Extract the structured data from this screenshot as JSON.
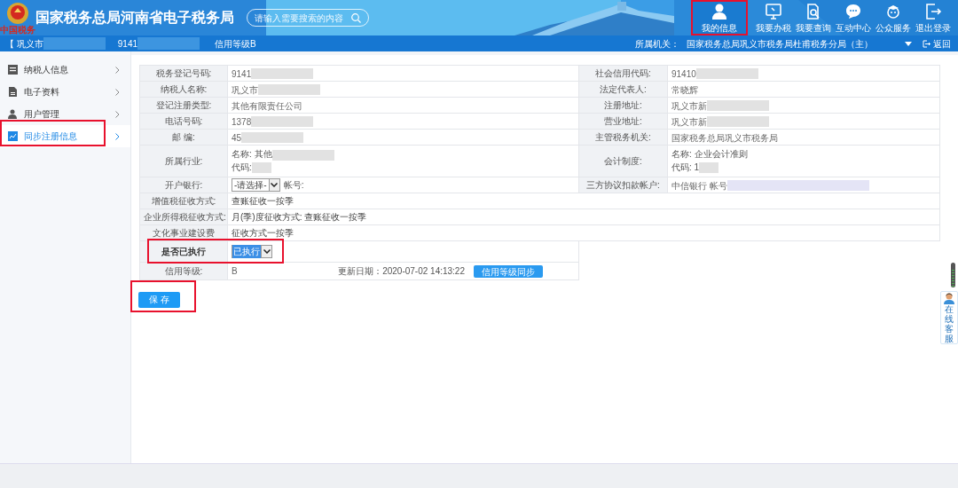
{
  "header": {
    "logo_text": "中国税务",
    "title": "国家税务总局河南省电子税务局",
    "search": {
      "placeholder": "请输入需要搜索的内容"
    },
    "nav": [
      {
        "label": "我的信息",
        "selected": true,
        "highlighted": true
      },
      {
        "label": "我要办税",
        "selected": false,
        "highlighted": false
      },
      {
        "label": "我要查询",
        "selected": false,
        "highlighted": false
      },
      {
        "label": "互动中心",
        "selected": false,
        "highlighted": false
      },
      {
        "label": "公众服务",
        "selected": false,
        "highlighted": false
      },
      {
        "label": "退出登录",
        "selected": false,
        "highlighted": false
      }
    ]
  },
  "info_bar": {
    "company": "【 巩义市",
    "tax_id": "9141",
    "credit": "信用等级B",
    "office_label": "所属机关：",
    "office": "国家税务总局巩义市税务局杜甫税务分局（主）",
    "back": "返回"
  },
  "sidebar": [
    {
      "label": "纳税人信息",
      "selected": false,
      "highlighted": false
    },
    {
      "label": "电子资料",
      "selected": false,
      "highlighted": false
    },
    {
      "label": "用户管理",
      "selected": false,
      "highlighted": false
    },
    {
      "label": "同步注册信息",
      "selected": true,
      "highlighted": true
    }
  ],
  "rows": [
    {
      "fields": [
        {
          "label": "税务登记号码:",
          "kind": "text",
          "value": "9141",
          "blurred": true
        },
        {
          "label": "社会信用代码:",
          "kind": "text",
          "value": "91410",
          "blurred": true
        }
      ]
    },
    {
      "fields": [
        {
          "label": "纳税人名称:",
          "kind": "text",
          "value": "巩义市",
          "blurred": true
        },
        {
          "label": "法定代表人:",
          "kind": "text",
          "value": "常晓辉"
        }
      ]
    },
    {
      "fields": [
        {
          "label": "登记注册类型:",
          "kind": "text",
          "value": "其他有限责任公司"
        },
        {
          "label": "注册地址:",
          "kind": "text",
          "value": "巩义市新",
          "blurred": true
        }
      ]
    },
    {
      "fields": [
        {
          "label": "电话号码:",
          "kind": "text",
          "value": "1378",
          "blurred": true
        },
        {
          "label": "营业地址:",
          "kind": "text",
          "value": "巩义市新",
          "blurred": true
        }
      ]
    },
    {
      "fields": [
        {
          "label": "邮 编:",
          "kind": "text",
          "value": "45",
          "blurred": true
        },
        {
          "label": "主管税务机关:",
          "kind": "text",
          "value": "国家税务总局巩义市税务局"
        }
      ]
    },
    {
      "fields": [
        {
          "label": "所属行业:",
          "kind": "lines",
          "lines": [
            {
              "text": "名称: 其他",
              "blurred": true
            },
            {
              "text": "代码:",
              "blurred": true
            }
          ]
        },
        {
          "label": "会计制度:",
          "kind": "lines",
          "lines": [
            {
              "text": "名称: 企业会计准则"
            },
            {
              "text": "代码: 1",
              "blurred": true
            }
          ]
        }
      ]
    },
    {
      "fields": [
        {
          "label": "开户银行:",
          "kind": "bank",
          "select": "-请选择-",
          "account_label": "帐号:"
        },
        {
          "label": "三方协议扣款帐户:",
          "kind": "text",
          "value": "中信银行  帐号",
          "blurred": true
        }
      ]
    },
    {
      "fields": [
        {
          "label": "增值税征收方式:",
          "kind": "wide",
          "value": "查账征收一按季"
        }
      ]
    },
    {
      "fields": [
        {
          "label": "企业所得税征收方式:",
          "kind": "wide",
          "value": "月(季)度征收方式:  查账征收一按季"
        }
      ]
    },
    {
      "fields": [
        {
          "label": "文化事业建设费",
          "kind": "wide",
          "value": "征收方式一按季"
        }
      ]
    },
    {
      "fields": [
        {
          "label": "是否已执行",
          "kind": "exec",
          "select": "已执行",
          "highlighted": true
        }
      ]
    },
    {
      "fields": [
        {
          "label": "信用等级:",
          "kind": "credit",
          "value": "B",
          "date": "更新日期：2020-07-02 14:13:22",
          "button": "信用等级同步"
        }
      ]
    }
  ],
  "save": {
    "label": "保 存",
    "highlighted": true
  },
  "service": {
    "label": "在线客服"
  }
}
